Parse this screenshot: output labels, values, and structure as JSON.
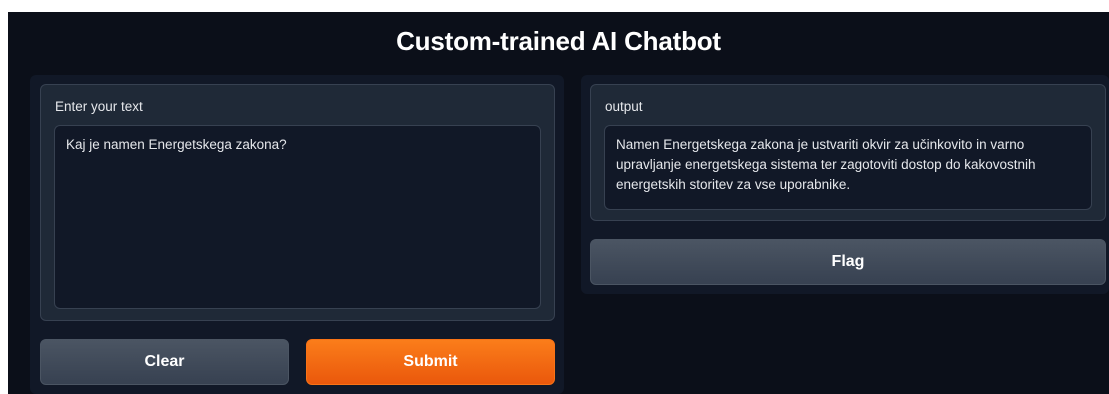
{
  "app": {
    "title": "Custom-trained AI Chatbot"
  },
  "input": {
    "label": "Enter your text",
    "value": "Kaj je namen Energetskega zakona?"
  },
  "output": {
    "label": "output",
    "value": "Namen Energetskega zakona je ustvariti okvir za učinkovito in varno upravljanje energetskega sistema ter zagotoviti dostop do kakovostnih energetskih storitev za vse uporabnike."
  },
  "buttons": {
    "clear": "Clear",
    "submit": "Submit",
    "flag": "Flag"
  },
  "colors": {
    "background": "#0b0f19",
    "panel": "#111827",
    "block": "#1f2937",
    "submit_accent": "#f97316",
    "secondary_button": "#4b5563"
  }
}
